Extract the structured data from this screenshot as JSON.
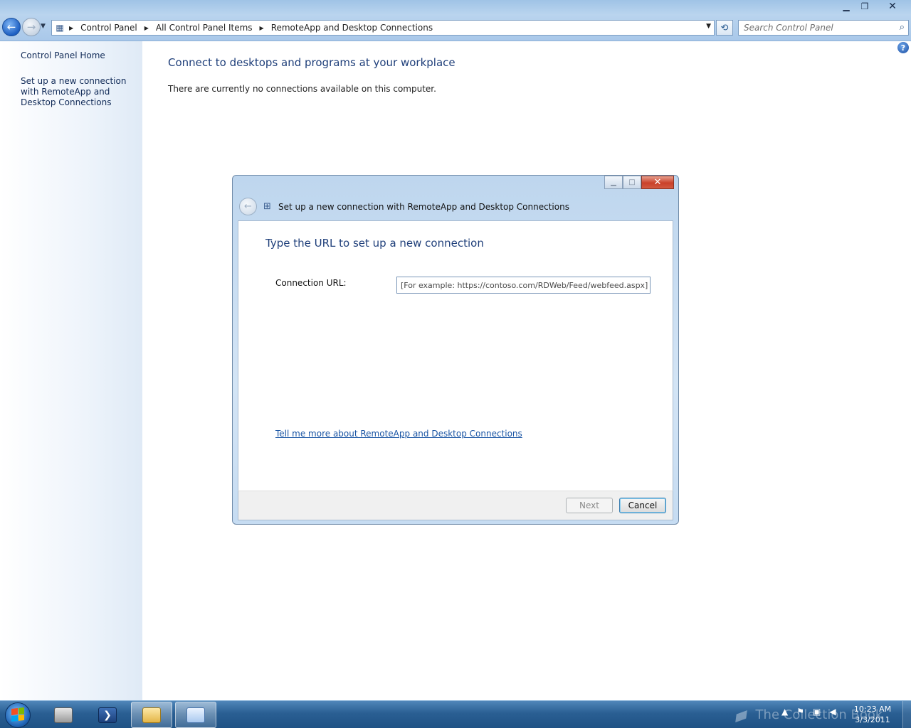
{
  "window": {
    "min_glyph": "▁",
    "max_glyph": "❐",
    "close_glyph": "✕"
  },
  "navigation": {
    "back_glyph": "←",
    "forward_glyph": "→",
    "history_glyph": "▼",
    "address_icon": "control-panel-icon",
    "breadcrumbs": [
      "Control Panel",
      "All Control Panel Items",
      "RemoteApp and Desktop Connections"
    ],
    "crumb_separator": "▶",
    "dropdown_glyph": "▼",
    "refresh_glyph": "⟲",
    "search_placeholder": "Search Control Panel",
    "search_glyph": "⌕"
  },
  "sidebar": {
    "home_label": "Control Panel Home",
    "setup_label": "Set up a new connection with RemoteApp and Desktop Connections"
  },
  "main": {
    "title": "Connect to desktops and programs at your workplace",
    "status": "There are currently no connections available on this computer.",
    "help_glyph": "?"
  },
  "dialog": {
    "title": "Set up a new connection with RemoteApp and Desktop Connections",
    "back_glyph": "←",
    "icon_glyph": "⊞",
    "min_glyph": "▁",
    "max_glyph": "□",
    "close_glyph": "✕",
    "heading": "Type the URL to set up a new connection",
    "url_label": "Connection URL:",
    "url_placeholder": "[For example: https://contoso.com/RDWeb/Feed/webfeed.aspx]",
    "url_value": "",
    "more_link": "Tell me more about RemoteApp and Desktop Connections",
    "next_label": "Next",
    "cancel_label": "Cancel"
  },
  "taskbar": {
    "ps_glyph": "❯",
    "tray": {
      "overflow_glyph": "▲",
      "flag_glyph": "⚑",
      "network_glyph": "▣",
      "volume_glyph": "◀"
    },
    "watermark": "The Collection Book",
    "watermark_glyph": "▰",
    "time": "10:23 AM",
    "date": "3/3/2011"
  },
  "colors": {
    "title_blue": "#1f3f7a",
    "link_blue": "#1a55a4",
    "taskbar": "#2a5f93"
  }
}
